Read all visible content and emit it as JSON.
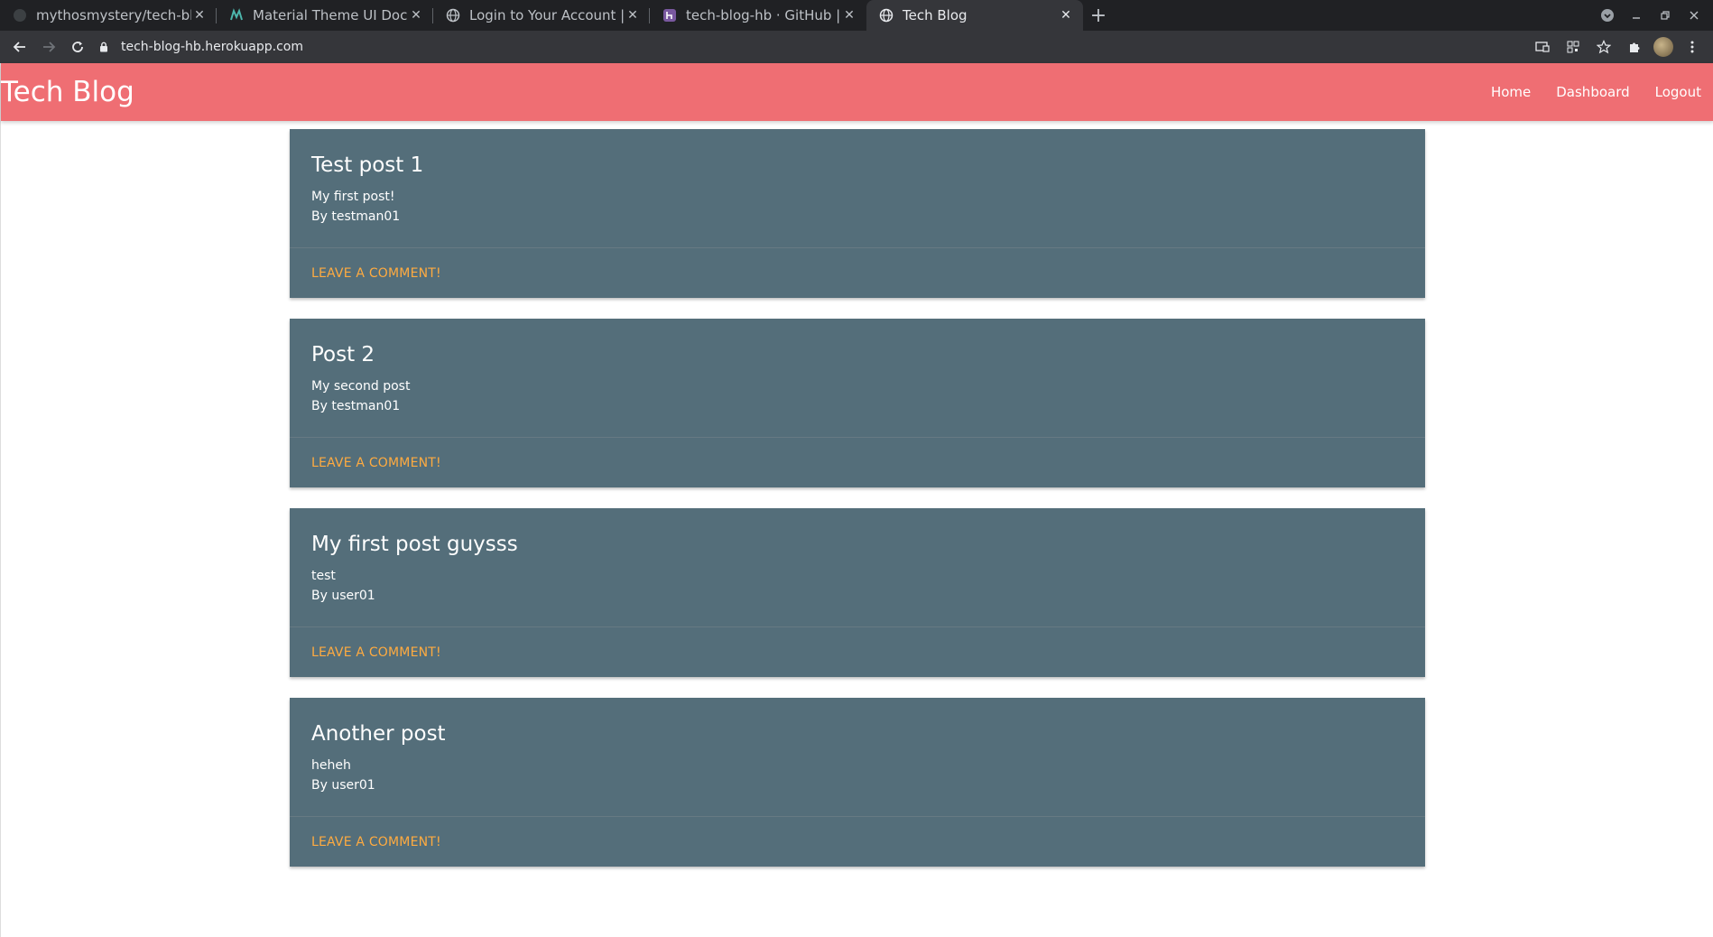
{
  "browser": {
    "tabs": [
      {
        "title": "mythosmystery/tech-blog",
        "icon": "github-icon"
      },
      {
        "title": "Material Theme UI Docum",
        "icon": "material-icon"
      },
      {
        "title": "Login to Your Account | Bo",
        "icon": "globe-icon"
      },
      {
        "title": "tech-blog-hb · GitHub | He",
        "icon": "heroku-icon"
      },
      {
        "title": "Tech Blog",
        "icon": "globe-icon"
      }
    ],
    "url": "tech-blog-hb.herokuapp.com",
    "colors": {
      "tabbar": "#202124",
      "toolbar": "#35363a"
    }
  },
  "site": {
    "brand": "Tech Blog",
    "nav": {
      "home": "Home",
      "dashboard": "Dashboard",
      "logout": "Logout"
    },
    "colors": {
      "navbar": "#ef6e73",
      "card": "#546e7a",
      "action": "#ffab40"
    }
  },
  "posts": [
    {
      "title": "Test post 1",
      "body": "My first post!",
      "author": "By testman01",
      "action": "LEAVE A COMMENT!"
    },
    {
      "title": "Post 2",
      "body": "My second post",
      "author": "By testman01",
      "action": "LEAVE A COMMENT!"
    },
    {
      "title": "My first post guysss",
      "body": "test",
      "author": "By user01",
      "action": "LEAVE A COMMENT!"
    },
    {
      "title": "Another post",
      "body": "heheh",
      "author": "By user01",
      "action": "LEAVE A COMMENT!"
    }
  ]
}
